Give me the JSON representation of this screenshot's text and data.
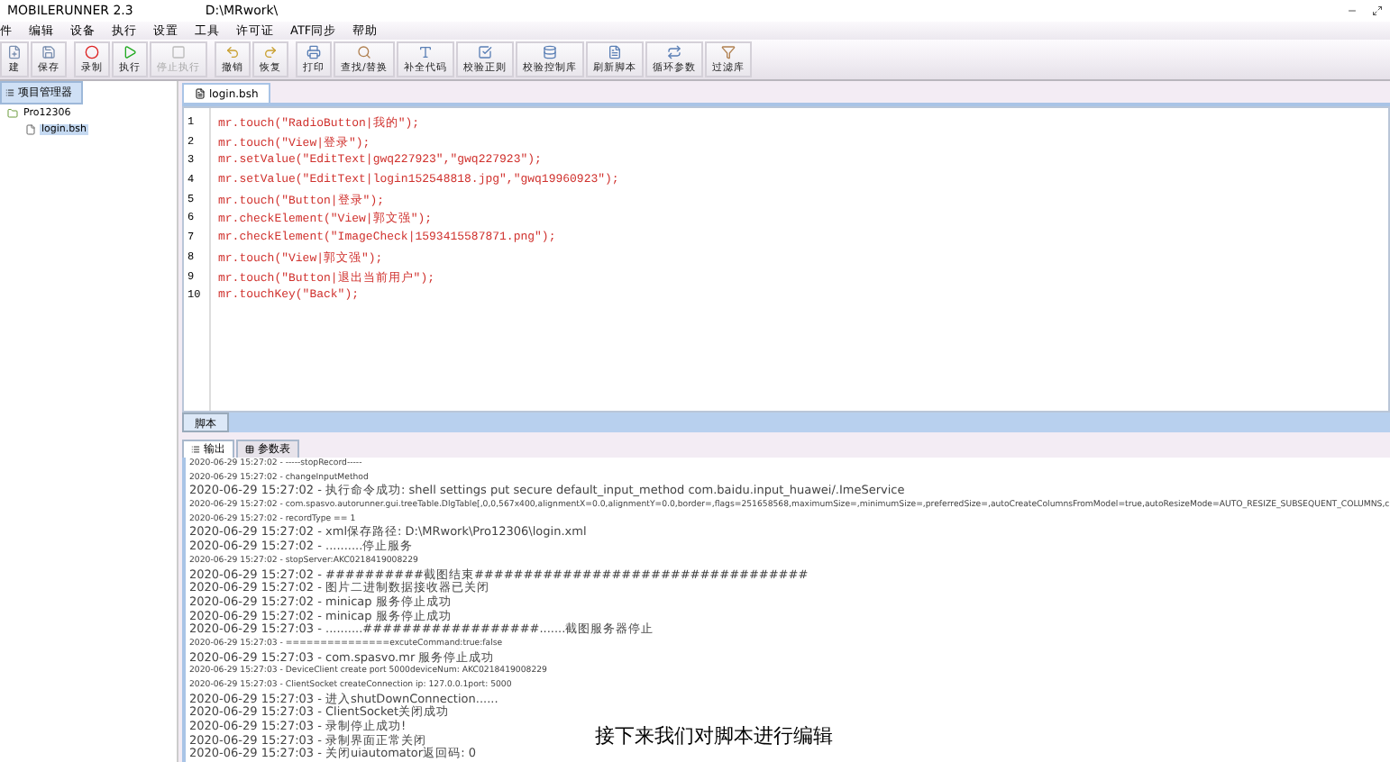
{
  "window": {
    "title": "MOBILERUNNER 2.3",
    "path": "D:\\MRwork\\"
  },
  "menu": [
    "件",
    "编辑",
    "设备",
    "执行",
    "设置",
    "工具",
    "许可证",
    "ATF同步",
    "帮助"
  ],
  "toolbar": [
    [
      {
        "label": "建",
        "disabled": false
      },
      {
        "label": "保存",
        "disabled": false
      }
    ],
    [
      {
        "label": "录制",
        "disabled": false
      },
      {
        "label": "执行",
        "disabled": false
      },
      {
        "label": "停止执行",
        "disabled": true
      }
    ],
    [
      {
        "label": "撤销",
        "disabled": false
      },
      {
        "label": "恢复",
        "disabled": false
      }
    ],
    [
      {
        "label": "打印",
        "disabled": false
      },
      {
        "label": "查找/替换",
        "disabled": false
      },
      {
        "label": "补全代码",
        "disabled": false
      },
      {
        "label": "校验正则",
        "disabled": false
      },
      {
        "label": "校验控制库",
        "disabled": false
      },
      {
        "label": "刷新脚本",
        "disabled": false
      },
      {
        "label": "循环参数",
        "disabled": false
      },
      {
        "label": "过滤库",
        "disabled": false
      }
    ]
  ],
  "sidebar": {
    "tab": "项目管理器",
    "tree": [
      {
        "label": "Pro12306",
        "selected": false,
        "children": [
          {
            "label": "login.bsh",
            "selected": true
          }
        ]
      }
    ]
  },
  "editor": {
    "tab": "login.bsh",
    "lines": [
      {
        "number": "1",
        "code": "mr.touch(\"RadioButton|我的\");"
      },
      {
        "number": "2",
        "code": "mr.touch(\"View|登录\");"
      },
      {
        "number": "3",
        "code": "mr.setValue(\"EditText|gwq227923\",\"gwq227923\");"
      },
      {
        "number": "4",
        "code": "mr.setValue(\"EditText|login152548818.jpg\",\"gwq19960923\");"
      },
      {
        "number": "5",
        "code": "mr.touch(\"Button|登录\");"
      },
      {
        "number": "6",
        "code": "mr.checkElement(\"View|郭文强\");"
      },
      {
        "number": "7",
        "code": "mr.checkElement(\"ImageCheck|1593415587871.png\");"
      },
      {
        "number": "8",
        "code": "mr.touch(\"View|郭文强\");"
      },
      {
        "number": "9",
        "code": "mr.touch(\"Button|退出当前用户\");"
      },
      {
        "number": "10",
        "code": "mr.touchKey(\"Back\");"
      }
    ],
    "bottom_tab": "脚本"
  },
  "output": {
    "tabs": [
      {
        "label": "输出",
        "selected": true
      },
      {
        "label": "参数表",
        "selected": false
      }
    ],
    "log": [
      "2020-06-29 15:27:02 - -----stopRecord-----",
      "2020-06-29 15:27:02 - changeInputMethod",
      "2020-06-29 15:27:02 - 执行命令成功:   shell settings put secure default_input_method com.baidu.input_huawei/.ImeService",
      "2020-06-29 15:27:02 - com.spasvo.autorunner.gui.treeTable.DlgTable[,0,0,567x400,alignmentX=0.0,alignmentY=0.0,border=,flags=251658568,maximumSize=,minimumSize=,preferredSize=,autoCreateColumnsFromModel=true,autoResizeMode=AUTO_RESIZE_SUBSEQUENT_COLUMNS,c",
      "2020-06-29 15:27:02 - recordType == 1",
      "2020-06-29 15:27:02 - xml保存路径: D:\\MRwork\\Pro12306\\login.xml",
      "2020-06-29 15:27:02 - ..........停止服务",
      "2020-06-29 15:27:02 - stopServer:AKC0218419008229",
      "2020-06-29 15:27:02 - ##########截图结束##################################",
      "2020-06-29 15:27:02 - 图片二进制数据接收器已关闭",
      "2020-06-29 15:27:02 - minicap 服务停止成功",
      "2020-06-29 15:27:02 - minicap 服务停止成功",
      "2020-06-29 15:27:03 - ..........##################.......截图服务器停止",
      "2020-06-29 15:27:03 - ===============excuteCommand:true:false",
      "2020-06-29 15:27:03 - com.spasvo.mr 服务停止成功",
      "2020-06-29 15:27:03 - DeviceClient create port 5000deviceNum: AKC0218419008229",
      "2020-06-29 15:27:03 - ClientSocket createConnection ip: 127.0.0.1port: 5000",
      "2020-06-29 15:27:03 - 进入shutDownConnection......",
      "2020-06-29 15:27:03 - ClientSocket关闭成功",
      "2020-06-29 15:27:03 - 录制停止成功!",
      "2020-06-29 15:27:03 - 录制界面正常关闭",
      "2020-06-29 15:27:03 - 关闭uiautomator返回码: 0"
    ]
  },
  "caption": "接下来我们对脚本进行编辑"
}
